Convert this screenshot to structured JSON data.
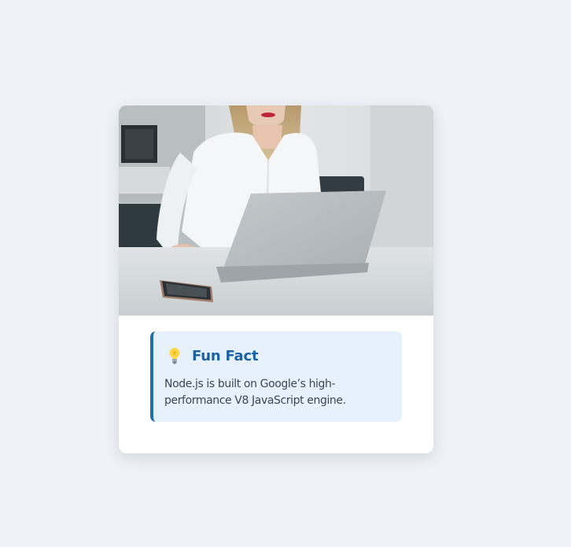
{
  "colors": {
    "page_background": "#eff3f8",
    "card_background": "#ffffff",
    "fact_background": "#e7f1fd",
    "fact_accent": "#1f6fae",
    "fact_title": "#1a62a4",
    "fact_text": "#3d4650"
  },
  "card": {
    "image": {
      "icon": "photo-woman-working-on-laptop"
    },
    "fun_fact": {
      "icon": "light-bulb-icon",
      "title": "Fun Fact",
      "text": "Node.js is built on Google’s high-performance V8 JavaScript engine."
    }
  }
}
